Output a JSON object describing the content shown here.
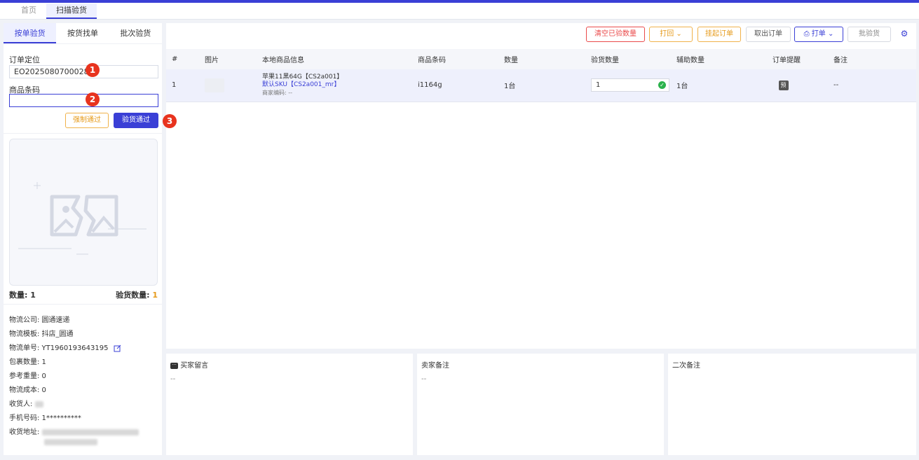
{
  "tabs": [
    {
      "label": "首页"
    },
    {
      "label": "扫描验货"
    }
  ],
  "left": {
    "subtabs": [
      "按单验货",
      "按货找单",
      "批次验货"
    ],
    "order_label": "订单定位",
    "order_value": "EO2025080700028",
    "barcode_label": "商品条码",
    "barcode_value": "",
    "force_pass": "强制通过",
    "verify_pass": "验货通过",
    "qty_label": "数量: 1",
    "verify_qty_label": "验货数量:",
    "verify_qty_value": "1",
    "steps": [
      "1",
      "2",
      "3"
    ],
    "info": {
      "company": "物流公司: 圆通速递",
      "template": "物流模板: 抖店_圆通",
      "tracking": "物流单号: YT1960193643195",
      "packages": "包裹数量: 1",
      "weight": "参考重量: 0",
      "cost": "物流成本: 0",
      "receiver_label": "收货人:",
      "phone": "手机号码: 1**********",
      "address_label": "收货地址:"
    }
  },
  "toolbar": {
    "clear": "清空已验数量",
    "return": "打回",
    "hold": "挂起订单",
    "take_out": "取出订单",
    "print": "打单",
    "batch": "批验货"
  },
  "table": {
    "headers": [
      "#",
      "图片",
      "本地商品信息",
      "商品条码",
      "数量",
      "验货数量",
      "辅助数量",
      "订单提醒",
      "备注"
    ],
    "rows": [
      {
        "index": "1",
        "name": "苹果11黑64G【CS2a001】",
        "sku": "默认SKU【CS2a001_mr】",
        "merchant_code": "商家编码: --",
        "barcode": "i1164g",
        "qty": "1台",
        "verify_qty": "1",
        "aux_qty": "1台",
        "reminder": "预",
        "remark": "--"
      }
    ]
  },
  "panels": {
    "buyer_msg": "买家留言",
    "buyer_msg_value": "--",
    "seller_note": "卖家备注",
    "seller_note_value": "--",
    "second_note": "二次备注"
  },
  "colors": {
    "primary": "#3a3fd6",
    "danger": "#ea4b4b",
    "warning": "#e69a1a",
    "badge": "#e8331e"
  }
}
